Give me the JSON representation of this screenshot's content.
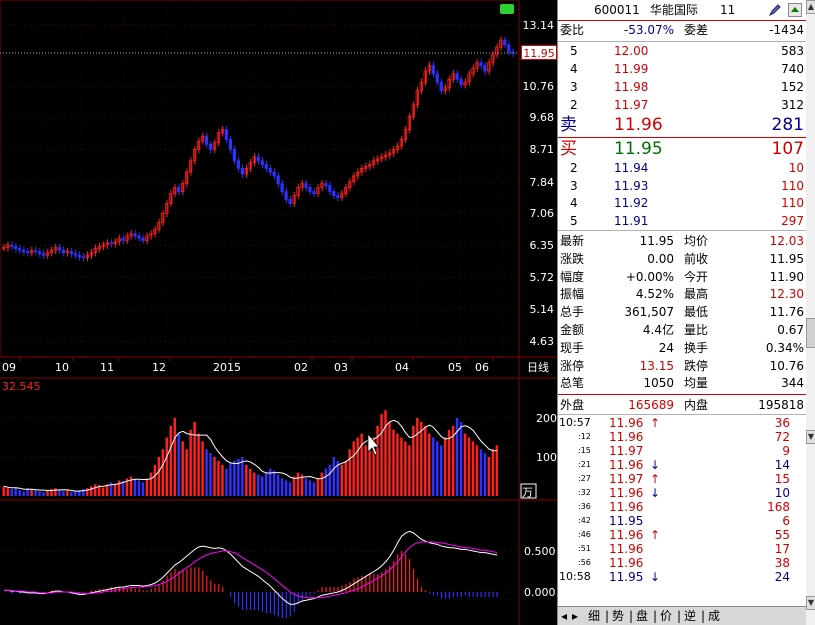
{
  "chart": {
    "price_ticks": [
      "13.14",
      "11.95",
      "10.76",
      "9.68",
      "8.71",
      "7.84",
      "7.06",
      "6.35",
      "5.72",
      "5.14",
      "4.63"
    ],
    "current_price_tag": "11.95",
    "month_labels": [
      "09",
      "10",
      "11",
      "12",
      "2015",
      "02",
      "03",
      "04",
      "05",
      "06"
    ],
    "period_label": "日线",
    "volume_indicator_value": "32.545",
    "volume_ticks": [
      "200",
      "100"
    ],
    "volume_unit": "万",
    "macd_ticks": [
      "0.500",
      "0.000"
    ],
    "colors": {
      "up": "#ff2020",
      "down": "#3030ff",
      "ma": "#ffffff",
      "grid": "#8b0000",
      "dif": "#ffffff",
      "dea": "#ff00ff"
    }
  },
  "chart_data": {
    "type": "candlestick",
    "note_series": "daily candles, volume bars and MACD as read approximately from the chart",
    "price": [
      6.3,
      6.35,
      6.32,
      6.28,
      6.25,
      6.22,
      6.2,
      6.24,
      6.22,
      6.18,
      6.15,
      6.2,
      6.25,
      6.3,
      6.25,
      6.2,
      6.22,
      6.18,
      6.15,
      6.12,
      6.1,
      6.15,
      6.2,
      6.28,
      6.32,
      6.35,
      6.4,
      6.38,
      6.42,
      6.5,
      6.45,
      6.55,
      6.6,
      6.55,
      6.5,
      6.45,
      6.55,
      6.6,
      6.7,
      6.85,
      7.05,
      7.3,
      7.55,
      7.7,
      7.6,
      7.8,
      8.1,
      8.4,
      8.7,
      8.95,
      9.1,
      8.85,
      8.7,
      8.9,
      9.2,
      9.3,
      9.0,
      8.7,
      8.4,
      8.2,
      8.05,
      8.2,
      8.35,
      8.5,
      8.4,
      8.3,
      8.2,
      8.1,
      8.0,
      7.8,
      7.6,
      7.4,
      7.3,
      7.5,
      7.7,
      7.8,
      7.7,
      7.6,
      7.55,
      7.7,
      7.8,
      7.75,
      7.6,
      7.5,
      7.45,
      7.55,
      7.7,
      7.85,
      8.0,
      8.1,
      8.2,
      8.25,
      8.3,
      8.4,
      8.45,
      8.5,
      8.55,
      8.6,
      8.7,
      8.8,
      9.0,
      9.3,
      9.7,
      10.1,
      10.6,
      10.9,
      11.3,
      11.5,
      11.2,
      10.9,
      10.6,
      10.7,
      11.0,
      11.2,
      11.0,
      10.8,
      10.9,
      11.2,
      11.4,
      11.6,
      11.5,
      11.3,
      11.6,
      11.9,
      12.2,
      12.5,
      12.3,
      12.0,
      11.95
    ],
    "volume_wan": [
      25,
      20,
      18,
      22,
      15,
      12,
      20,
      18,
      15,
      12,
      10,
      15,
      18,
      20,
      15,
      12,
      14,
      10,
      12,
      15,
      18,
      20,
      25,
      30,
      28,
      22,
      30,
      35,
      32,
      40,
      38,
      45,
      50,
      42,
      40,
      35,
      45,
      60,
      80,
      100,
      120,
      150,
      180,
      200,
      160,
      140,
      120,
      170,
      190,
      160,
      140,
      120,
      110,
      100,
      90,
      80,
      70,
      85,
      90,
      95,
      100,
      80,
      70,
      60,
      55,
      50,
      60,
      70,
      65,
      55,
      45,
      40,
      35,
      50,
      60,
      55,
      45,
      40,
      35,
      45,
      60,
      70,
      80,
      100,
      90,
      80,
      90,
      120,
      140,
      150,
      160,
      130,
      140,
      150,
      180,
      210,
      220,
      190,
      170,
      160,
      150,
      140,
      130,
      180,
      200,
      190,
      180,
      160,
      150,
      140,
      130,
      150,
      170,
      180,
      200,
      190,
      160,
      150,
      140,
      130,
      120,
      110,
      100,
      120,
      130
    ],
    "macd_dif": [
      0.02,
      0.02,
      0.01,
      0.01,
      0.0,
      0.0,
      -0.01,
      -0.01,
      -0.01,
      -0.02,
      -0.02,
      -0.01,
      0.0,
      0.01,
      0.01,
      0.0,
      0.0,
      -0.01,
      -0.02,
      -0.03,
      -0.03,
      -0.02,
      -0.01,
      0.0,
      0.01,
      0.02,
      0.03,
      0.04,
      0.05,
      0.06,
      0.06,
      0.07,
      0.08,
      0.08,
      0.08,
      0.07,
      0.08,
      0.09,
      0.11,
      0.14,
      0.18,
      0.23,
      0.28,
      0.33,
      0.36,
      0.4,
      0.44,
      0.48,
      0.52,
      0.55,
      0.56,
      0.55,
      0.54,
      0.53,
      0.54,
      0.53,
      0.5,
      0.46,
      0.41,
      0.36,
      0.31,
      0.28,
      0.25,
      0.22,
      0.19,
      0.15,
      0.11,
      0.07,
      0.02,
      -0.03,
      -0.08,
      -0.12,
      -0.15,
      -0.15,
      -0.13,
      -0.11,
      -0.1,
      -0.09,
      -0.08,
      -0.06,
      -0.04,
      -0.03,
      -0.02,
      -0.01,
      0.0,
      0.02,
      0.04,
      0.07,
      0.1,
      0.13,
      0.16,
      0.19,
      0.22,
      0.25,
      0.28,
      0.32,
      0.37,
      0.43,
      0.51,
      0.6,
      0.68,
      0.72,
      0.74,
      0.72,
      0.68,
      0.64,
      0.62,
      0.6,
      0.59,
      0.58,
      0.56,
      0.55,
      0.54,
      0.54,
      0.53,
      0.52,
      0.52,
      0.51,
      0.5,
      0.49,
      0.48,
      0.48,
      0.47,
      0.46,
      0.45
    ],
    "macd_dea": [
      0.02,
      0.02,
      0.02,
      0.01,
      0.01,
      0.01,
      0.0,
      0.0,
      0.0,
      -0.01,
      -0.01,
      -0.01,
      -0.01,
      0.0,
      0.0,
      0.0,
      0.0,
      0.0,
      -0.01,
      -0.01,
      -0.02,
      -0.02,
      -0.02,
      -0.01,
      -0.01,
      0.0,
      0.01,
      0.01,
      0.02,
      0.03,
      0.04,
      0.05,
      0.05,
      0.06,
      0.06,
      0.06,
      0.07,
      0.07,
      0.08,
      0.09,
      0.11,
      0.13,
      0.16,
      0.19,
      0.23,
      0.26,
      0.3,
      0.33,
      0.37,
      0.4,
      0.43,
      0.45,
      0.47,
      0.48,
      0.49,
      0.5,
      0.5,
      0.49,
      0.48,
      0.45,
      0.42,
      0.39,
      0.36,
      0.33,
      0.3,
      0.27,
      0.24,
      0.2,
      0.16,
      0.12,
      0.08,
      0.04,
      0.0,
      -0.03,
      -0.05,
      -0.06,
      -0.07,
      -0.07,
      -0.07,
      -0.07,
      -0.07,
      -0.06,
      -0.05,
      -0.04,
      -0.03,
      -0.02,
      -0.01,
      0.01,
      0.02,
      0.04,
      0.06,
      0.09,
      0.11,
      0.14,
      0.17,
      0.2,
      0.23,
      0.27,
      0.32,
      0.37,
      0.43,
      0.49,
      0.54,
      0.58,
      0.6,
      0.61,
      0.61,
      0.61,
      0.61,
      0.6,
      0.6,
      0.59,
      0.58,
      0.57,
      0.56,
      0.55,
      0.54,
      0.54,
      0.53,
      0.52,
      0.51,
      0.51,
      0.5,
      0.49,
      0.48
    ]
  },
  "quote": {
    "code": "600011",
    "name": "华能国际",
    "extra": "11",
    "ratio_label": "委比",
    "ratio_value": "-53.07%",
    "diff_label": "委差",
    "diff_value": "-1434",
    "sell_rows": [
      {
        "level": "5",
        "price": "12.00",
        "vol": "583"
      },
      {
        "level": "4",
        "price": "11.99",
        "vol": "740"
      },
      {
        "level": "3",
        "price": "11.98",
        "vol": "152"
      },
      {
        "level": "2",
        "price": "11.97",
        "vol": "312"
      }
    ],
    "sell1": {
      "label": "卖",
      "price": "11.96",
      "vol": "281"
    },
    "buy1": {
      "label": "买",
      "price": "11.95",
      "vol": "107"
    },
    "buy_rows": [
      {
        "level": "2",
        "price": "11.94",
        "vol": "10"
      },
      {
        "level": "3",
        "price": "11.93",
        "vol": "110"
      },
      {
        "level": "4",
        "price": "11.92",
        "vol": "110"
      },
      {
        "level": "5",
        "price": "11.91",
        "vol": "297"
      }
    ],
    "stats": [
      {
        "l1": "最新",
        "v1": "11.95",
        "c1": "black",
        "l2": "均价",
        "v2": "12.03",
        "c2": "red"
      },
      {
        "l1": "涨跌",
        "v1": "0.00",
        "c1": "black",
        "l2": "前收",
        "v2": "11.95",
        "c2": "black"
      },
      {
        "l1": "幅度",
        "v1": "+0.00%",
        "c1": "black",
        "l2": "今开",
        "v2": "11.90",
        "c2": "black"
      },
      {
        "l1": "振幅",
        "v1": "4.52%",
        "c1": "black",
        "l2": "最高",
        "v2": "12.30",
        "c2": "red"
      },
      {
        "l1": "总手",
        "v1": "361,507",
        "c1": "black",
        "l2": "最低",
        "v2": "11.76",
        "c2": "black"
      },
      {
        "l1": "金额",
        "v1": "4.4亿",
        "c1": "black",
        "l2": "量比",
        "v2": "0.67",
        "c2": "black"
      },
      {
        "l1": "现手",
        "v1": "24",
        "c1": "black",
        "l2": "换手",
        "v2": "0.34%",
        "c2": "black"
      },
      {
        "l1": "涨停",
        "v1": "13.15",
        "c1": "red",
        "l2": "跌停",
        "v2": "10.76",
        "c2": "black"
      },
      {
        "l1": "总笔",
        "v1": "1050",
        "c1": "black",
        "l2": "均量",
        "v2": "344",
        "c2": "black"
      }
    ],
    "outer_label": "外盘",
    "outer_value": "165689",
    "inner_label": "内盘",
    "inner_value": "195818",
    "ticks": [
      {
        "time": "10:57",
        "price": "11.96",
        "dir": "up",
        "vol": "36",
        "big": true
      },
      {
        "time": ":12",
        "price": "11.96",
        "dir": "",
        "vol": "72"
      },
      {
        "time": ":15",
        "price": "11.97",
        "dir": "",
        "vol": "9"
      },
      {
        "time": ":21",
        "price": "11.96",
        "dir": "down",
        "vol": "14"
      },
      {
        "time": ":27",
        "price": "11.97",
        "dir": "up",
        "vol": "15"
      },
      {
        "time": ":32",
        "price": "11.96",
        "dir": "down",
        "vol": "10"
      },
      {
        "time": ":36",
        "price": "11.96",
        "dir": "",
        "vol": "168"
      },
      {
        "time": ":42",
        "price": "11.95",
        "dir": "",
        "vol": "6"
      },
      {
        "time": ":46",
        "price": "11.96",
        "dir": "up",
        "vol": "55"
      },
      {
        "time": ":51",
        "price": "11.96",
        "dir": "",
        "vol": "17"
      },
      {
        "time": ":56",
        "price": "11.96",
        "dir": "",
        "vol": "38"
      },
      {
        "time": "10:58",
        "price": "11.95",
        "dir": "down",
        "vol": "24",
        "big": true
      }
    ],
    "tabs": [
      "细",
      "势",
      "盘",
      "价",
      "逆",
      "成"
    ]
  }
}
